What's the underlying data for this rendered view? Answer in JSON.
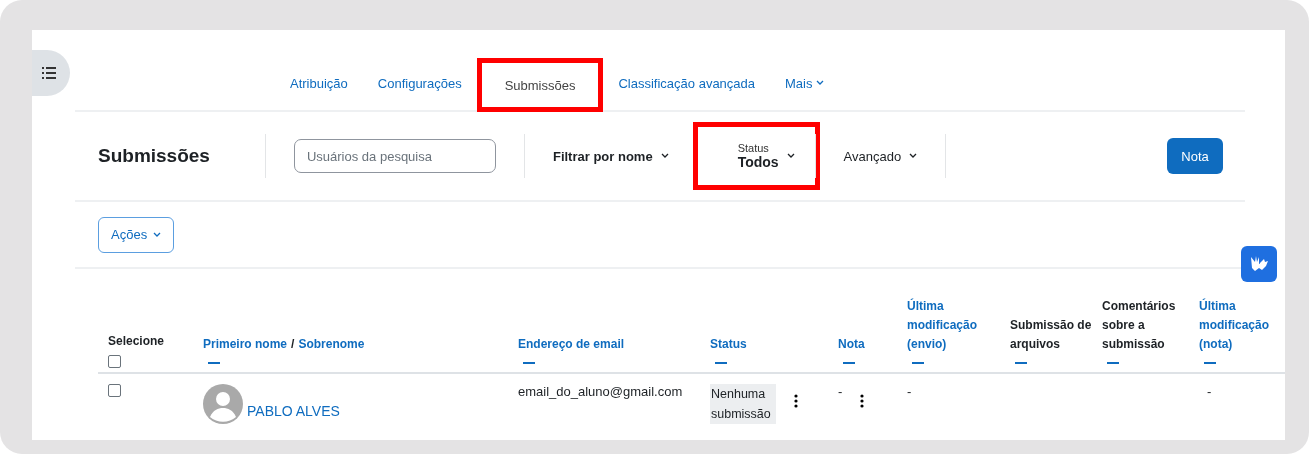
{
  "tabs": [
    {
      "label": "Atribuição",
      "selected": false,
      "highlighted": false,
      "kind": "link"
    },
    {
      "label": "Configurações",
      "selected": false,
      "highlighted": false,
      "kind": "link"
    },
    {
      "label": "Submissões",
      "selected": true,
      "highlighted": true,
      "kind": "link"
    },
    {
      "label": "Classificação avançada",
      "selected": false,
      "highlighted": false,
      "kind": "link"
    },
    {
      "label": "Mais",
      "selected": false,
      "highlighted": false,
      "kind": "menu"
    }
  ],
  "toolbar": {
    "heading": "Submissões",
    "search": {
      "placeholder": "Usuários da pesquisa"
    },
    "filters": [
      {
        "kind": "strong",
        "label": "Filtrar por nome",
        "highlighted": false
      },
      {
        "kind": "labeled",
        "caption": "Status",
        "label": "Todos",
        "highlighted": true
      },
      {
        "kind": "normal",
        "label": "Avançado",
        "highlighted": false
      }
    ],
    "grade_button": "Nota"
  },
  "actions_button": "Ações",
  "table": {
    "columns": [
      {
        "kind": "select",
        "label": "Selecione",
        "checked": false
      },
      {
        "kind": "pair",
        "links": [
          "Primeiro nome",
          "Sobrenome"
        ],
        "separator": "/"
      },
      {
        "kind": "link",
        "label": "Endereço de email"
      },
      {
        "kind": "link",
        "label": "Status"
      },
      {
        "kind": "link",
        "label": "Nota"
      },
      {
        "kind": "link",
        "label": "Última modificação (envio)"
      },
      {
        "kind": "plain",
        "label": "Submissão de arquivos"
      },
      {
        "kind": "plain",
        "label": "Comentários sobre a submissão"
      },
      {
        "kind": "link",
        "label": "Última modificação (nota)"
      }
    ],
    "rows": [
      {
        "selected": false,
        "name": "PABLO ALVES",
        "email": "email_do_aluno@gmail.com",
        "status": "Nenhuma submissão",
        "grade": "-",
        "last_modified_submission": "-",
        "last_modified_grade": "-"
      }
    ]
  }
}
